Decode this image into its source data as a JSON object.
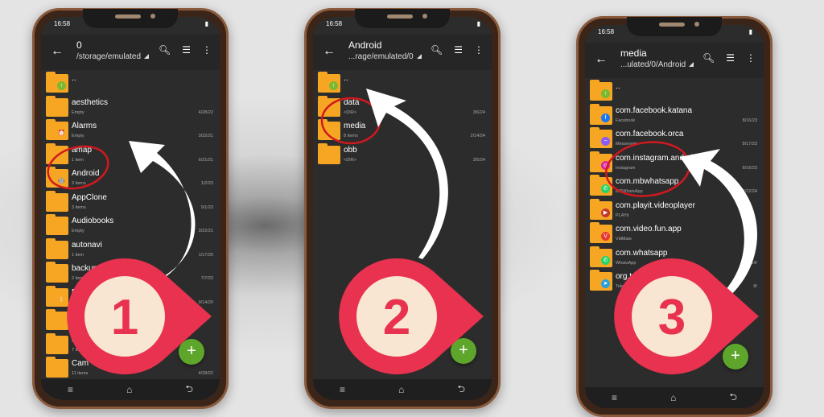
{
  "phones": [
    {
      "time": "16:58",
      "title": "0",
      "path": "/storage/emulated",
      "rows": [
        {
          "name": "..",
          "sub": "",
          "date": "",
          "glyph": "up"
        },
        {
          "name": "aesthetics",
          "sub": "Empty",
          "date": "4/28/22"
        },
        {
          "name": "Alarms",
          "sub": "Empty",
          "date": "3/22/21",
          "glyph": "alarm"
        },
        {
          "name": "amap",
          "sub": "1 item",
          "date": "6/21/21"
        },
        {
          "name": "Android",
          "sub": "3 items",
          "date": "1/2/23",
          "glyph": "android"
        },
        {
          "name": "AppClone",
          "sub": "3 items",
          "date": "9/1/23"
        },
        {
          "name": "Audiobooks",
          "sub": "Empty",
          "date": "3/22/21"
        },
        {
          "name": "autonavi",
          "sub": "1 item",
          "date": "1/17/20"
        },
        {
          "name": "backups",
          "sub": "2 items",
          "date": "7/7/23"
        },
        {
          "name": "Blu",
          "sub": "Empty",
          "date": "9/14/20",
          "glyph": "bluetooth"
        },
        {
          "name": "c",
          "sub": "",
          "date": ""
        },
        {
          "name": "c",
          "sub": "7 items",
          "date": ""
        },
        {
          "name": "Cam",
          "sub": "11 items",
          "date": "4/28/22"
        },
        {
          "name": "Cardboard",
          "sub": "Empty",
          "date": "9/19/22"
        }
      ],
      "step": "1"
    },
    {
      "time": "16:58",
      "title": "Android",
      "path": "...rage/emulated/0",
      "rows": [
        {
          "name": "..",
          "sub": "",
          "date": "",
          "glyph": "up"
        },
        {
          "name": "data",
          "sub": "<DIR>",
          "date": "3/6/24"
        },
        {
          "name": "media",
          "sub": "8 items",
          "date": "2/14/24"
        },
        {
          "name": "obb",
          "sub": "<DIR>",
          "date": "3/5/24"
        }
      ],
      "step": "2"
    },
    {
      "time": "16:58",
      "title": "media",
      "path": "...ulated/0/Android",
      "rows": [
        {
          "name": "..",
          "sub": "",
          "date": "",
          "glyph": "up"
        },
        {
          "name": "com.facebook.katana",
          "sub": "Facebook",
          "date": "8/16/23",
          "glyph": "facebook"
        },
        {
          "name": "com.facebook.orca",
          "sub": "Messenger",
          "date": "8/17/23",
          "glyph": "messenger"
        },
        {
          "name": "com.instagram.android",
          "sub": "Instagram",
          "date": "8/16/23",
          "glyph": "instagram"
        },
        {
          "name": "com.mbwhatsapp",
          "sub": "MBWhatsApp",
          "date": "2/22/24",
          "glyph": "whatsapp"
        },
        {
          "name": "com.playit.videoplayer",
          "sub": "PLAYit",
          "date": "",
          "glyph": "playit"
        },
        {
          "name": "com.video.fun.app",
          "sub": "VidMate",
          "date": "9/15",
          "glyph": "vidmate"
        },
        {
          "name": "com.whatsapp",
          "sub": "WhatsApp",
          "date": "8/14/",
          "glyph": "whatsapp"
        },
        {
          "name": "org.telegram",
          "sub": "Telegram",
          "date": "8/",
          "glyph": "telegram"
        }
      ],
      "step": "3"
    }
  ],
  "colors": {
    "folder": "#f6a623",
    "fab": "#5ea62b",
    "badge": "#e8324f",
    "badge_inner": "#f8e6d2",
    "circle": "#d0191e"
  }
}
